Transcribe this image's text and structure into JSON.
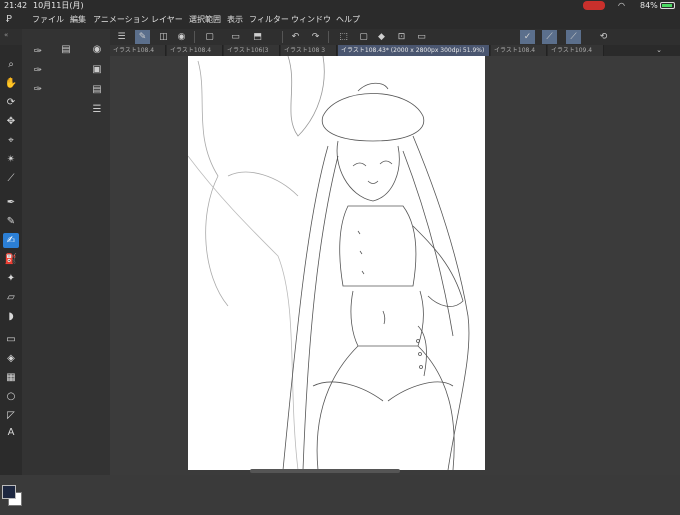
{
  "status": {
    "time": "21:42",
    "date": "10月11日(月)",
    "battery": "84%"
  },
  "menu": {
    "items": [
      "ファイル",
      "編集",
      "アニメーション",
      "レイヤー",
      "選択範囲",
      "表示",
      "フィルター",
      "ウィンドウ",
      "ヘルプ"
    ]
  },
  "toolbar": {
    "icons": [
      "menu-icon",
      "pen-tool-icon",
      "layer-icon",
      "eye-icon",
      "new-file-icon",
      "open-icon",
      "save-icon",
      "undo-icon",
      "redo-icon",
      "select-icon",
      "clear-icon",
      "fill-icon",
      "transform-icon",
      "stroke-icon",
      "brush-icon",
      "pen-icon",
      "rotate-icon"
    ]
  },
  "tabs": [
    {
      "label": "イラスト108.4",
      "active": false
    },
    {
      "label": "イラスト108.4",
      "active": false
    },
    {
      "label": "イラスト106(3",
      "active": false
    },
    {
      "label": "イラスト108 3",
      "active": false
    },
    {
      "label": "イラスト108.43* (2000 x 2800px 300dpi 51.9%)",
      "active": true
    },
    {
      "label": "イラスト108.4",
      "active": false
    },
    {
      "label": "イラスト109.4",
      "active": false
    }
  ],
  "tools": [
    "zoom-icon",
    "hand-icon",
    "rotate-view-icon",
    "move-icon",
    "select-layer-icon",
    "magic-wand-icon",
    "eyedropper-icon",
    "pen-icon",
    "pencil-icon",
    "brush-icon",
    "airbrush-icon",
    "decoration-icon",
    "eraser-icon",
    "blend-icon",
    "figure-icon",
    "fill-icon",
    "gradient-icon",
    "ellipse-icon",
    "ruler-icon",
    "text-icon"
  ],
  "colors": {
    "accent": "#2b7fd6",
    "foreground": "#1d2740",
    "background": "#ffffff"
  }
}
